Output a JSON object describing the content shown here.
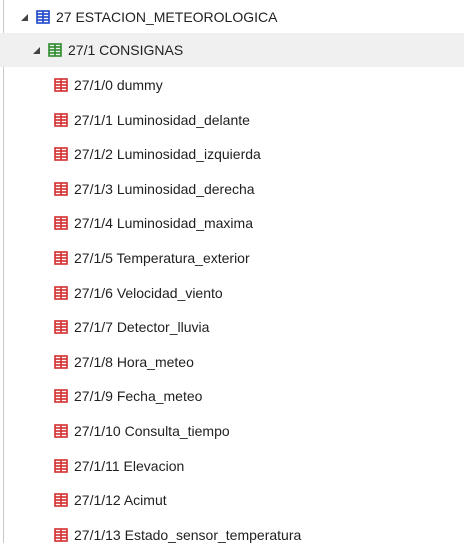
{
  "tree": {
    "root": {
      "label": "27 ESTACION_METEOROLOGICA",
      "icon": "group-address-range-icon",
      "icon_color": "#1b47c9",
      "expanded": true
    },
    "middle": {
      "label": "27/1 CONSIGNAS",
      "icon": "middle-group-icon",
      "icon_color": "#2e8b2e",
      "expanded": true,
      "selected": true
    },
    "items": [
      {
        "label": "27/1/0 dummy",
        "icon": "group-address-icon"
      },
      {
        "label": "27/1/1 Luminosidad_delante",
        "icon": "group-address-icon"
      },
      {
        "label": "27/1/2 Luminosidad_izquierda",
        "icon": "group-address-icon"
      },
      {
        "label": "27/1/3 Luminosidad_derecha",
        "icon": "group-address-icon"
      },
      {
        "label": "27/1/4 Luminosidad_maxima",
        "icon": "group-address-icon"
      },
      {
        "label": "27/1/5 Temperatura_exterior",
        "icon": "group-address-icon"
      },
      {
        "label": "27/1/6 Velocidad_viento",
        "icon": "group-address-icon"
      },
      {
        "label": "27/1/7 Detector_lluvia",
        "icon": "group-address-icon"
      },
      {
        "label": "27/1/8 Hora_meteo",
        "icon": "group-address-icon"
      },
      {
        "label": "27/1/9 Fecha_meteo",
        "icon": "group-address-icon"
      },
      {
        "label": "27/1/10 Consulta_tiempo",
        "icon": "group-address-icon"
      },
      {
        "label": "27/1/11 Elevacion",
        "icon": "group-address-icon"
      },
      {
        "label": "27/1/12 Acimut",
        "icon": "group-address-icon"
      },
      {
        "label": "27/1/13 Estado_sensor_temperatura",
        "icon": "group-address-icon"
      }
    ],
    "item_icon_color": "#d32f2f",
    "expander_color": "#444444"
  }
}
